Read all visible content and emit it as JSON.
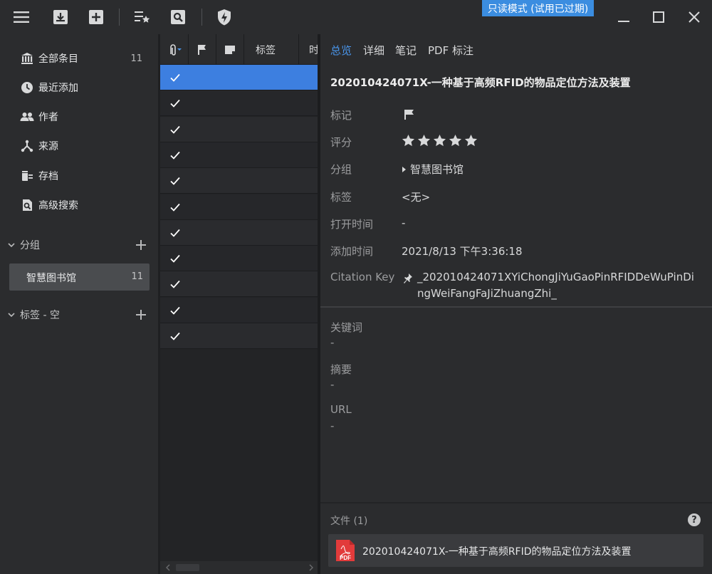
{
  "toolbar": {
    "menu_icon": "hamburger-icon",
    "import_icon": "download-box-icon",
    "add_icon": "plus-box-icon",
    "sort_icon": "list-star-icon",
    "search_icon": "search-box-icon",
    "plugin_icon": "lightning-shield-icon",
    "readonly_badge": "只读模式 (试用已过期)",
    "minimize_icon": "minimize-icon",
    "maximize_icon": "maximize-icon",
    "close_icon": "close-icon"
  },
  "sidebar": {
    "items": [
      {
        "label": "全部条目",
        "count": "11",
        "icon": "library-icon"
      },
      {
        "label": "最近添加",
        "count": "",
        "icon": "clock-icon"
      },
      {
        "label": "作者",
        "count": "",
        "icon": "people-icon"
      },
      {
        "label": "来源",
        "count": "",
        "icon": "source-icon"
      },
      {
        "label": "存档",
        "count": "",
        "icon": "archive-icon"
      },
      {
        "label": "高级搜索",
        "count": "",
        "icon": "advanced-search-icon"
      }
    ],
    "groups_section": "分组",
    "groups": [
      {
        "label": "智慧图书馆",
        "count": "11"
      }
    ],
    "tags_section": "标签 - 空"
  },
  "list": {
    "columns": [
      "标签",
      "时"
    ],
    "rows": [
      {
        "checked": true,
        "selected": true
      },
      {
        "checked": true,
        "selected": false
      },
      {
        "checked": true,
        "selected": false
      },
      {
        "checked": true,
        "selected": false
      },
      {
        "checked": true,
        "selected": false
      },
      {
        "checked": true,
        "selected": false
      },
      {
        "checked": true,
        "selected": false
      },
      {
        "checked": true,
        "selected": false
      },
      {
        "checked": true,
        "selected": false
      },
      {
        "checked": true,
        "selected": false
      },
      {
        "checked": true,
        "selected": false
      }
    ]
  },
  "detail": {
    "tabs": [
      "总览",
      "详细",
      "笔记",
      "PDF 标注"
    ],
    "active_tab": "总览",
    "title": "202010424071X-一种基于高频RFID的物品定位方法及装置",
    "fields": {
      "flag_label": "标记",
      "rating_label": "评分",
      "rating": 5,
      "group_label": "分组",
      "group_value": "智慧图书馆",
      "tags_label": "标签",
      "tags_value": "<无>",
      "opened_label": "打开时间",
      "opened_value": "-",
      "added_label": "添加时间",
      "added_value": "2021/8/13 下午3:36:18",
      "citation_label": "Citation Key",
      "citation_line1": "_202010424071XYiChongJiYuGaoPinRFIDDeWuPinDi",
      "citation_line2": "ngWeiFangFaJiZhuangZhi_"
    },
    "meta": {
      "keywords_label": "关键词",
      "keywords_value": "-",
      "abstract_label": "摘要",
      "abstract_value": "-",
      "url_label": "URL",
      "url_value": "-"
    },
    "files": {
      "header": "文件 (1)",
      "help": "?",
      "items": [
        {
          "name": "202010424071X-一种基于高频RFID的物品定位方法及装置",
          "type_label": "PDF"
        }
      ]
    }
  },
  "colors": {
    "accent": "#3d7fe0",
    "active_tab": "#4a96ec",
    "badge": "#3b8de0",
    "pdf_red": "#e23b3b"
  }
}
